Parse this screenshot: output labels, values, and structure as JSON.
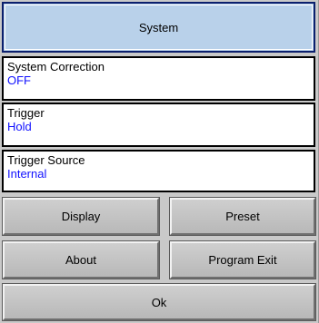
{
  "menu": {
    "title": "System",
    "fields": [
      {
        "label": "System Correction",
        "value": "OFF"
      },
      {
        "label": "Trigger",
        "value": "Hold"
      },
      {
        "label": "Trigger Source",
        "value": "Internal"
      }
    ],
    "buttons": {
      "display": "Display",
      "preset": "Preset",
      "about": "About",
      "program_exit": "Program Exit",
      "ok": "Ok"
    }
  }
}
